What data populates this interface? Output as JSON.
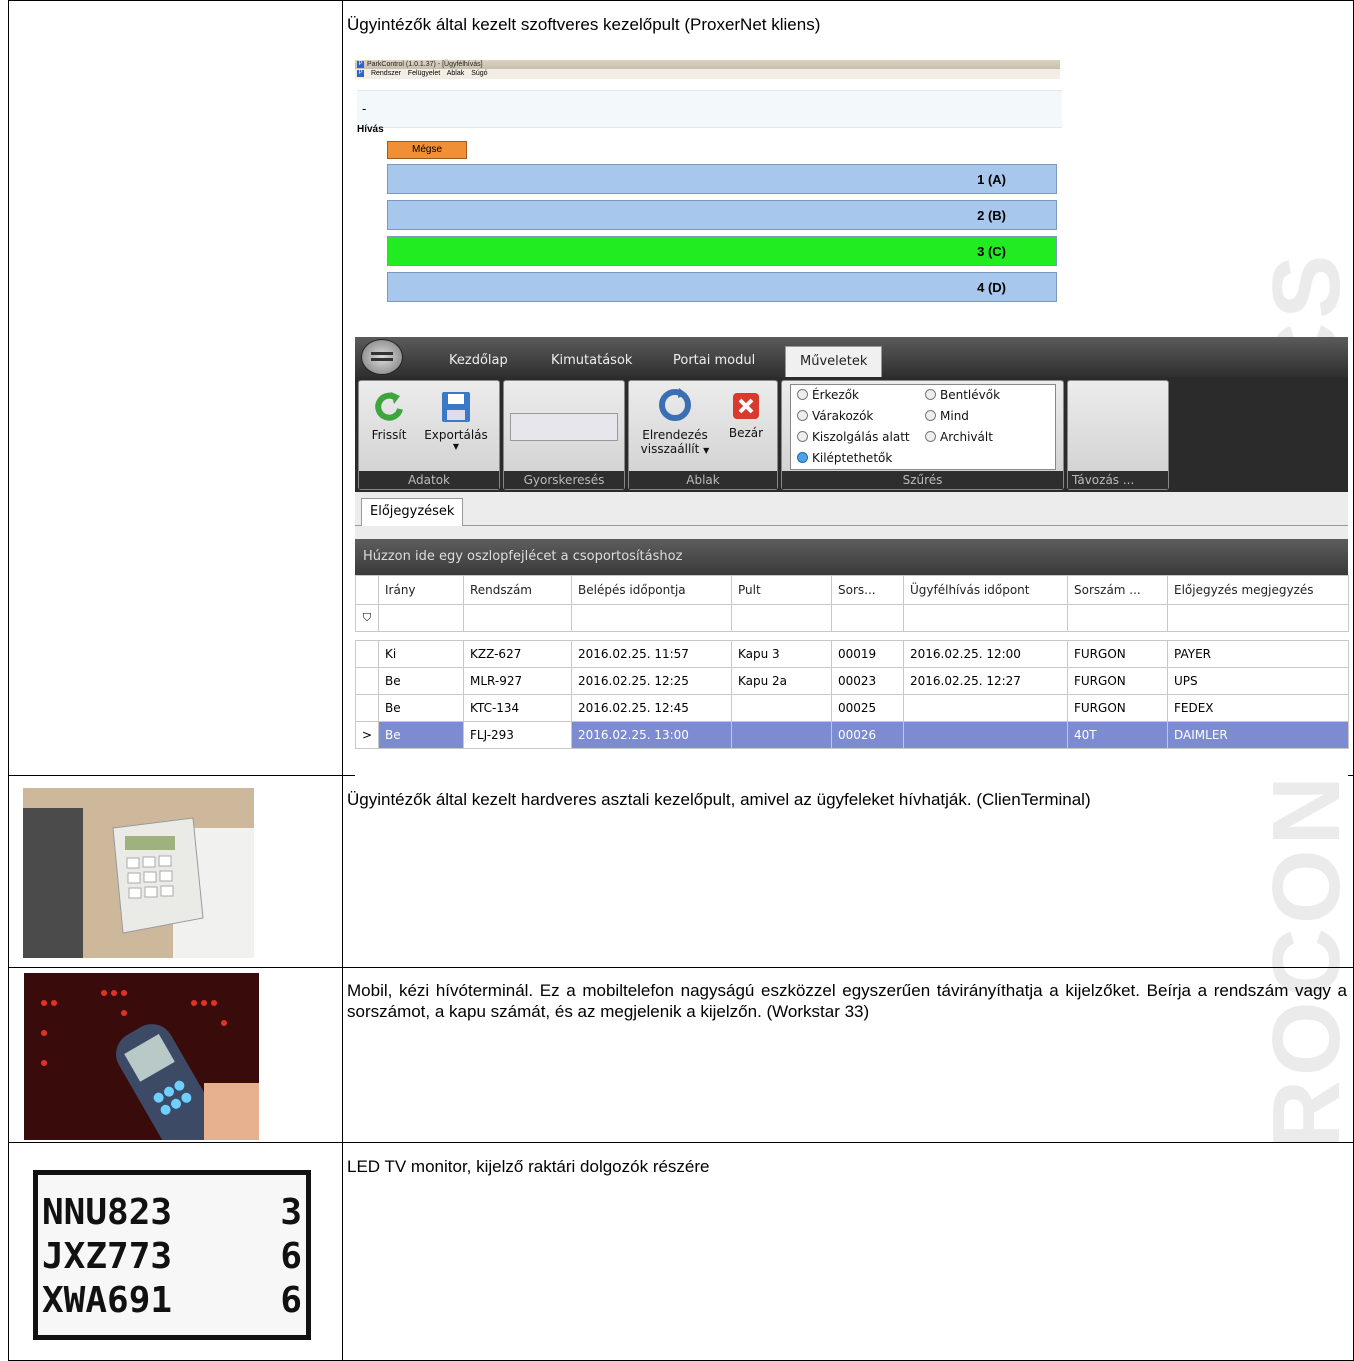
{
  "watermark": "ROCON ITRONICS",
  "rows": [
    {
      "caption": "Ügyintézők által kezelt szoftveres kezelőpult (ProxerNet kliens)"
    },
    {
      "caption": "Ügyintézők által kezelt hardveres asztali kezelőpult, amivel az ügyfeleket hívhatják. (ClienTerminal)"
    },
    {
      "caption": "Mobil, kézi hívóterminál. Ez a mobiltelefon nagyságú eszközzel egyszerűen távirányíthatja a kijelzőket. Beírja a rendszám vagy a sorszámot, a kapu számát, és az megjelenik a kijelzőn. (Workstar 33)"
    },
    {
      "caption": "LED TV monitor, kijelző raktári dolgozók részére"
    }
  ],
  "parkcontrol": {
    "title": "ParkControl (1.0.1.37) - [Ügyfélhívás]",
    "menu": [
      "Rendszer",
      "Felügyelet",
      "Ablak",
      "Súgó"
    ],
    "status": "-",
    "section": "Hívás",
    "cancel": "Mégse",
    "counters": [
      "1 (A)",
      "2 (B)",
      "3 (C)",
      "4 (D)"
    ],
    "active_counter": "3 (C)"
  },
  "app": {
    "tabs": [
      "Kezdőlap",
      "Kimutatások",
      "Portai modul",
      "Műveletek"
    ],
    "selected_tab": "Műveletek",
    "groups": {
      "adatok": {
        "label": "Adatok",
        "refresh": "Frissít",
        "export": "Exportálás"
      },
      "gyors": {
        "label": "Gyorskeresés"
      },
      "ablak": {
        "label": "Ablak",
        "reset1": "Elrendezés",
        "reset2": "visszaállít",
        "close": "Bezár"
      },
      "szures": {
        "label": "Szűrés",
        "options": [
          "Érkezők",
          "Bentlévők",
          "Várakozók",
          "Mind",
          "Kiszolgálás alatt",
          "Archivált",
          "Kiléptethetők"
        ],
        "selected": "Kiléptethetők"
      },
      "tavozas": {
        "label": "Távozás ..."
      }
    },
    "doc_tab": "Előjegyzések",
    "group_hint": "Húzzon ide egy oszlopfejlécet a csoportosításhoz",
    "columns": [
      "Irány",
      "Rendszám",
      "Belépés időpontja",
      "Pult",
      "Sors...",
      "Ügyfélhívás időpont",
      "Sorszám ...",
      "Előjegyzés megjegyzés"
    ],
    "records": [
      [
        "Ki",
        "KZZ-627",
        "2016.02.25. 11:57",
        "Kapu 3",
        "00019",
        "2016.02.25. 12:00",
        "FURGON",
        "PAYER"
      ],
      [
        "Be",
        "MLR-927",
        "2016.02.25. 12:25",
        "Kapu 2a",
        "00023",
        "2016.02.25. 12:27",
        "FURGON",
        "UPS"
      ],
      [
        "Be",
        "KTC-134",
        "2016.02.25. 12:45",
        "",
        "00025",
        "",
        "FURGON",
        "FEDEX"
      ],
      [
        "Be",
        "FLJ-293",
        "2016.02.25. 13:00",
        "",
        "00026",
        "",
        "40T",
        "DAIMLER"
      ]
    ]
  },
  "led_display": [
    {
      "plate": "NNU823",
      "gate": "3"
    },
    {
      "plate": "JXZ773",
      "gate": "6"
    },
    {
      "plate": "XWA691",
      "gate": "6"
    }
  ],
  "colors": {
    "counter": "#a7c7ec",
    "active": "#21ec21",
    "cancel": "#f08f35",
    "selected_row": "#7d8bd0"
  }
}
